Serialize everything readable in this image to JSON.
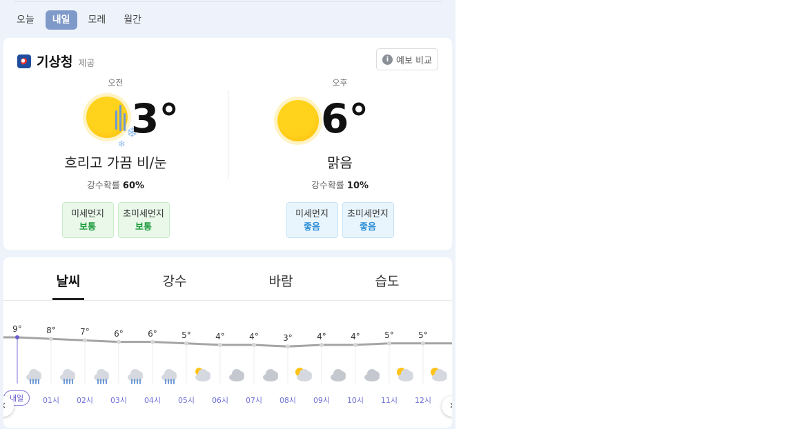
{
  "day_tabs": [
    "오늘",
    "내일",
    "모레",
    "월간"
  ],
  "active_day_tab": 1,
  "provider": {
    "name": "기상청",
    "suffix": "제공"
  },
  "compare_button": "예보 비교",
  "am": {
    "period": "오전",
    "temp": "3°",
    "condition": "흐리고 가끔 비/눈",
    "precip_label": "강수확률",
    "precip_value": "60%",
    "dust": [
      {
        "label": "미세먼지",
        "value": "보통"
      },
      {
        "label": "초미세먼지",
        "value": "보통"
      }
    ]
  },
  "pm": {
    "period": "오후",
    "temp": "6°",
    "condition": "맑음",
    "precip_label": "강수확률",
    "precip_value": "10%",
    "dust": [
      {
        "label": "미세먼지",
        "value": "좋음"
      },
      {
        "label": "초미세먼지",
        "value": "좋음"
      }
    ]
  },
  "chart_tabs": [
    "날씨",
    "강수",
    "바람",
    "습도"
  ],
  "active_chart_tab": 0,
  "hourly_today_label": "내일",
  "hourly": [
    {
      "time": "",
      "temp": "9°",
      "value": 9,
      "icon": "rain-icon"
    },
    {
      "time": "01시",
      "temp": "8°",
      "value": 8,
      "icon": "rain-icon"
    },
    {
      "time": "02시",
      "temp": "7°",
      "value": 7,
      "icon": "rain-icon"
    },
    {
      "time": "03시",
      "temp": "6°",
      "value": 6,
      "icon": "rain-icon"
    },
    {
      "time": "04시",
      "temp": "6°",
      "value": 6,
      "icon": "rain-icon"
    },
    {
      "time": "05시",
      "temp": "5°",
      "value": 5,
      "icon": "cloud-night-icon"
    },
    {
      "time": "06시",
      "temp": "4°",
      "value": 4,
      "icon": "cloudy-icon"
    },
    {
      "time": "07시",
      "temp": "4°",
      "value": 4,
      "icon": "cloudy-icon"
    },
    {
      "time": "08시",
      "temp": "3°",
      "value": 3,
      "icon": "partly-sunny-icon"
    },
    {
      "time": "09시",
      "temp": "4°",
      "value": 4,
      "icon": "cloudy-icon"
    },
    {
      "time": "10시",
      "temp": "4°",
      "value": 4,
      "icon": "cloudy-icon"
    },
    {
      "time": "11시",
      "temp": "5°",
      "value": 5,
      "icon": "partly-sunny-icon"
    },
    {
      "time": "12시",
      "temp": "5°",
      "value": 5,
      "icon": "partly-sunny-icon"
    }
  ]
}
